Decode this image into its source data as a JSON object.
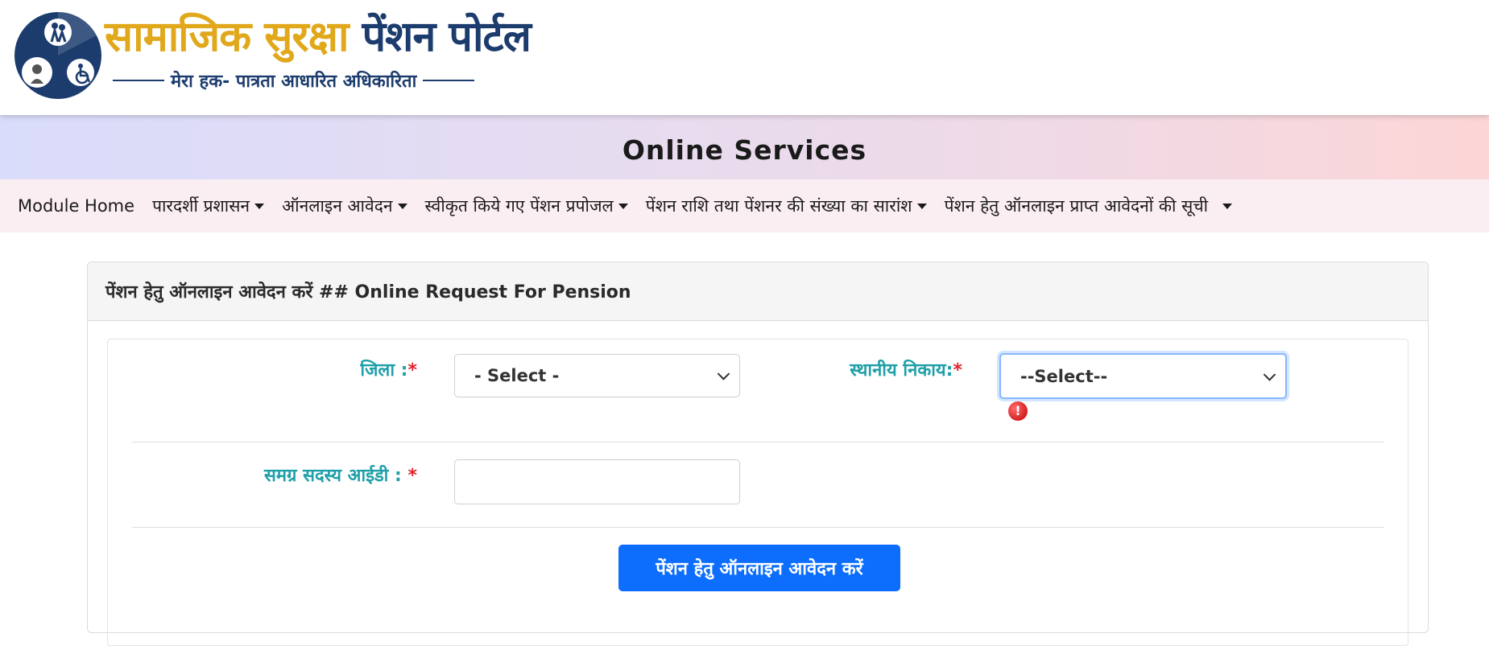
{
  "logo": {
    "title_part1": "सामाजिक सुरक्षा",
    "title_part2": "पेंशन पोर्टल",
    "tagline": "मेरा हक- पात्रता आधारित अधिकारिता",
    "emblem_colors": {
      "circle": "#1c3c6e",
      "accent": "#e0a81a"
    }
  },
  "banner": {
    "title": "Online Services"
  },
  "nav": {
    "items": [
      {
        "label": "Module Home",
        "dropdown": false
      },
      {
        "label": "पारदर्शी प्रशासन",
        "dropdown": true
      },
      {
        "label": "ऑनलाइन आवेदन",
        "dropdown": true
      },
      {
        "label": "स्वीकृत किये गए पेंशन प्रपोजल",
        "dropdown": true
      },
      {
        "label": "पेंशन राशि तथा पेंशनर की संख्या का सारांश",
        "dropdown": true
      },
      {
        "label": "पेंशन हेतु ऑनलाइन प्राप्त आवेदनों की सूची",
        "dropdown": true
      }
    ]
  },
  "form": {
    "header": "पेंशन हेतु ऑनलाइन आवेदन करें ## Online Request For Pension",
    "district": {
      "label": "जिला :",
      "required_mark": "*",
      "selected": "- Select -"
    },
    "local_body": {
      "label": "स्थानीय निकाय:",
      "required_mark": "*",
      "selected": "--Select--",
      "error_icon": "!"
    },
    "member_id": {
      "label": "समग्र सदस्य आईडी : ",
      "required_mark": "*",
      "value": ""
    },
    "submit_label": "पेंशन हेतु ऑनलाइन आवेदन करें"
  },
  "colors": {
    "label": "#1f9fa8",
    "required": "#e0242b",
    "primary": "#0d6efd",
    "nav_bg": "#fbeef3"
  }
}
